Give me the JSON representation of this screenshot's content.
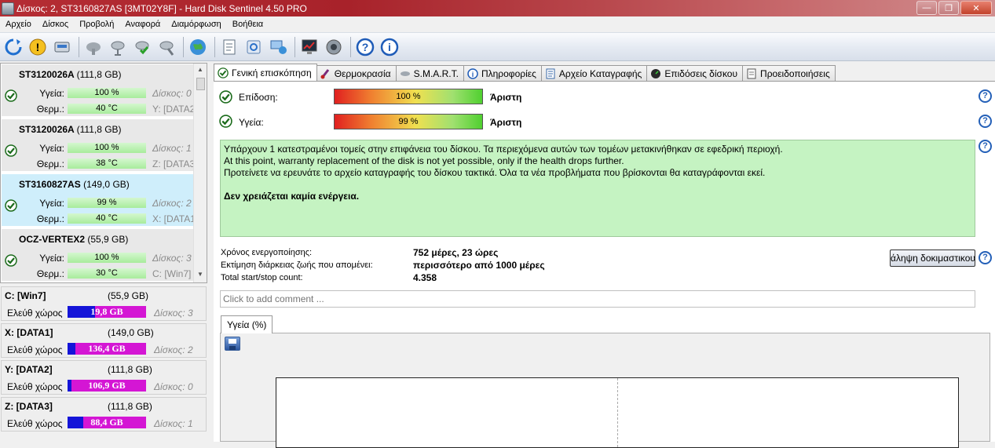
{
  "window": {
    "title": "Δίσκος: 2, ST3160827AS [3MT02Y8F]  -  Hard Disk Sentinel 4.50 PRO",
    "buttons": {
      "minimize": "—",
      "maximize": "❐",
      "close": "✕"
    }
  },
  "menu": [
    "Αρχείο",
    "Δίσκος",
    "Προβολή",
    "Αναφορά",
    "Διαμόρφωση",
    "Βοήθεια"
  ],
  "toolbar": {
    "icons": [
      "refresh-icon",
      "warning-icon",
      "drive-icon",
      "cloud-disk-icon",
      "disk-network-icon",
      "disk-check-icon",
      "disk-settings-icon",
      "globe-icon",
      "report-icon",
      "sync-icon",
      "network-monitor-icon",
      "monitor-chart-icon",
      "speaker-icon",
      "help-icon",
      "info-icon"
    ]
  },
  "disks": [
    {
      "name": "ST3120026A",
      "size": "(111,8 GB)",
      "health_label": "Υγεία:",
      "health": "100 %",
      "temp_label": "Θερμ.:",
      "temp": "40 °C",
      "disk": "Δίσκος: 0",
      "volume": "Y: [DATA2"
    },
    {
      "name": "ST3120026A",
      "size": "(111,8 GB)",
      "health_label": "Υγεία:",
      "health": "100 %",
      "temp_label": "Θερμ.:",
      "temp": "38 °C",
      "disk": "Δίσκος: 1",
      "volume": "Z: [DATA3"
    },
    {
      "name": "ST3160827AS",
      "size": "(149,0 GB)",
      "health_label": "Υγεία:",
      "health": "99 %",
      "temp_label": "Θερμ.:",
      "temp": "40 °C",
      "disk": "Δίσκος: 2",
      "volume": "X: [DATA1"
    },
    {
      "name": "OCZ-VERTEX2",
      "size": "(55,9 GB)",
      "health_label": "Υγεία:",
      "health": "100 %",
      "temp_label": "Θερμ.:",
      "temp": "30 °C",
      "disk": "Δίσκος: 3",
      "volume": "C: [Win7]"
    }
  ],
  "volumes": [
    {
      "name": "C: [Win7]",
      "size": "(55,9 GB)",
      "free_label": "Ελεύθ χώρος",
      "free": "19,8 GB",
      "free_fraction": 0.35,
      "disk": "Δίσκος: 3"
    },
    {
      "name": "X: [DATA1]",
      "size": "(149,0 GB)",
      "free_label": "Ελεύθ χώρος",
      "free": "136,4 GB",
      "free_fraction": 0.1,
      "disk": "Δίσκος: 2"
    },
    {
      "name": "Y: [DATA2]",
      "size": "(111,8 GB)",
      "free_label": "Ελεύθ χώρος",
      "free": "106,9 GB",
      "free_fraction": 0.05,
      "disk": "Δίσκος: 0"
    },
    {
      "name": "Z: [DATA3]",
      "size": "(111,8 GB)",
      "free_label": "Ελεύθ χώρος",
      "free": "88,4 GB",
      "free_fraction": 0.2,
      "disk": "Δίσκος: 1"
    }
  ],
  "tabs": [
    "Γενική επισκόπηση",
    "Θερμοκρασία",
    "S.M.A.R.T.",
    "Πληροφορίες",
    "Αρχείο Καταγραφής",
    "Επιδόσεις δίσκου",
    "Προειδοποιήσεις"
  ],
  "overview": {
    "performance_label": "Επίδοση:",
    "performance_value": "100 %",
    "performance_rating": "Άριστη",
    "health_label": "Υγεία:",
    "health_value": "99 %",
    "health_rating": "Άριστη",
    "message": [
      "Υπάρχουν 1 κατεστραμένοι τομείς στην επιφάνεια του δίσκου. Τα περιεχόμενα αυτών των τομέων μετακινήθηκαν σε εφεδρική περιοχή.",
      "At this point, warranty replacement of the disk is not yet possible, only if the health drops further.",
      "Προτείνετε να ερευνάτε το αρχείο καταγραφής του δίσκου τακτικά. Όλα τα νέα προβλήματα που βρίσκονται θα καταγράφονται εκεί."
    ],
    "message_bold": "Δεν χρειάζεται καμία ενέργεια.",
    "power_on_label": "Χρόνος ενεργοποίησης:",
    "power_on_value": "752 μέρες, 23 ώρες",
    "lifetime_label": "Εκτίμηση διάρκειας ζωής που απομένει:",
    "lifetime_value": "περισσότερο από 1000 μέρες",
    "startstop_label": "Total start/stop count:",
    "startstop_value": "4.358",
    "test_button": "άληψη δοκιμαστικου",
    "comment_placeholder": "Click to add comment ...",
    "chart_tab": "Υγεία (%)",
    "help": "?"
  },
  "colors": {
    "title_bar": "#b52d34",
    "selected_disk": "#cfeefb",
    "message_bg": "#c5f3c2",
    "free_space": "#1414d8",
    "used_space": "#d416d4"
  }
}
